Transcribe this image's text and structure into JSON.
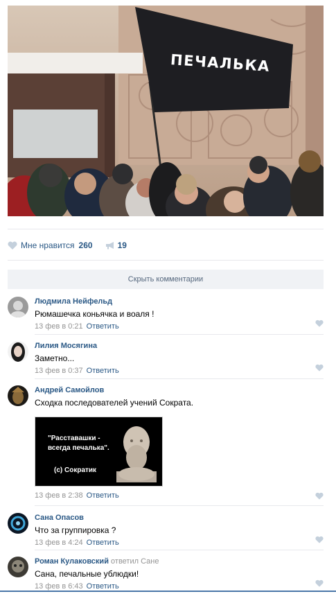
{
  "post": {
    "flag_text": "ПЕЧАЛЬКА",
    "likes_label": "Мне нравится",
    "likes_count": "260",
    "share_count": "19",
    "hide_comments_label": "Скрыть комментарии"
  },
  "comments": [
    {
      "author": "Людмила Нейфельд",
      "text": "Рюмашечка коньячка и воаля !",
      "date": "13 фев в 0:21",
      "reply_label": "Ответить"
    },
    {
      "author": "Лилия Мосягина",
      "text": "Заметно...",
      "date": "13 фев в 0:37",
      "reply_label": "Ответить"
    },
    {
      "author": "Андрей Самойлов",
      "text": "Сходка последователей учений Сократа.",
      "attachment_line1": "\"Расставашки -",
      "attachment_line2": "всегда печалька\".",
      "attachment_sign": "(с) Сократик",
      "date": "13 фев в 2:38",
      "reply_label": "Ответить"
    },
    {
      "author": "Сана Опасов",
      "text": "Что за группировка ?",
      "date": "13 фев в 4:24",
      "reply_label": "Ответить"
    },
    {
      "author": "Роман Кулаковский",
      "reply_to_label": "ответил",
      "reply_to_name": "Сане",
      "text": "Сана, печальные ублюдки!",
      "date": "13 фев в 6:43",
      "reply_label": "Ответить"
    }
  ],
  "icons": {
    "like": "heart-icon",
    "share": "megaphone-icon"
  },
  "colors": {
    "link": "#2a5885",
    "meta": "#939393",
    "button_bg": "#f0f2f5",
    "heart": "#c4d0dc",
    "accent_line": "#4a76a8"
  }
}
